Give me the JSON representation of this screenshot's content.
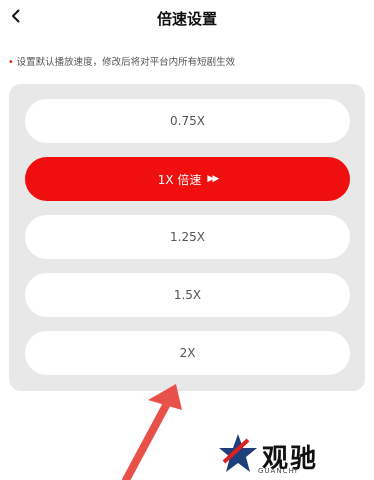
{
  "header": {
    "title": "倍速设置",
    "back_icon": "chevron-left-icon"
  },
  "hint": {
    "bullet": "•",
    "text": "设置默认播放速度，修改后将对平台内所有短剧生效"
  },
  "speed_options": [
    {
      "label": "0.75X",
      "selected": false
    },
    {
      "label": "1X 倍速",
      "selected": true
    },
    {
      "label": "1.25X",
      "selected": false
    },
    {
      "label": "1.5X",
      "selected": false
    },
    {
      "label": "2X",
      "selected": false
    }
  ],
  "selected_indicator_icon": "fast-forward-icon",
  "watermark": {
    "name": "观驰",
    "sub": "GUANCHI"
  },
  "colors": {
    "accent": "#f00f0f",
    "panel_bg": "#e8e8e8",
    "arrow": "#e8504a"
  }
}
